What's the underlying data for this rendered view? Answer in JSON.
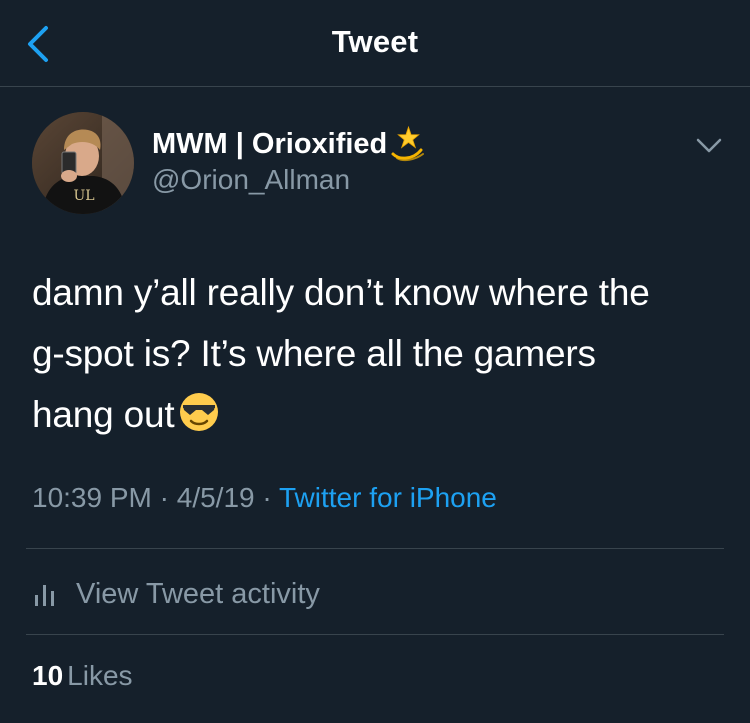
{
  "header": {
    "title": "Tweet",
    "back_icon": "chevron-left-icon"
  },
  "author": {
    "display_name": "MWM | Orioxified",
    "name_emoji": "dizzy-star-emoji",
    "handle": "@Orion_Allman",
    "avatar_icon": "profile-photo"
  },
  "tweet": {
    "line1": "damn y’all really don’t know where the",
    "line2": "g-spot is? It’s where all the gamers",
    "line3": "hang out",
    "emoji": "sunglasses-emoji"
  },
  "meta": {
    "time": "10:39 PM",
    "separator1": " · ",
    "date": "4/5/19",
    "separator2": " · ",
    "source": "Twitter for iPhone"
  },
  "activity": {
    "label": "View Tweet activity",
    "icon": "bar-chart-icon"
  },
  "likes": {
    "count": "10",
    "label": "Likes"
  },
  "colors": {
    "background": "#15202b",
    "divider": "#38444d",
    "secondary_text": "#8899a6",
    "accent": "#1da1f2"
  }
}
